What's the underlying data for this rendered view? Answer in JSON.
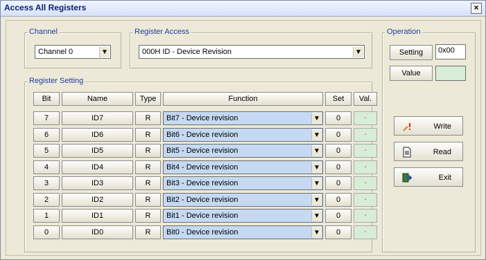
{
  "window": {
    "title": "Access All Registers",
    "close_glyph": "×"
  },
  "channel": {
    "label": "Channel",
    "value": "Channel 0"
  },
  "register_access": {
    "label": "Register Access",
    "value": "000H ID - Device Revision"
  },
  "operation": {
    "label": "Operation",
    "setting_label": "Setting",
    "setting_value": "0x00",
    "value_label": "Value",
    "value_value": "",
    "write_label": "Write",
    "read_label": "Read",
    "exit_label": "Exit",
    "write_icon": "write-icon",
    "read_icon": "document-icon",
    "exit_icon": "exit-icon"
  },
  "register_setting": {
    "label": "Register Setting",
    "headers": {
      "bit": "Bit",
      "name": "Name",
      "type": "Type",
      "function": "Function",
      "set": "Set",
      "val": "Val."
    },
    "rows": [
      {
        "bit": "7",
        "name": "ID7",
        "type": "R",
        "function": "Bit7 - Device revision",
        "set": "0",
        "val": "-"
      },
      {
        "bit": "6",
        "name": "ID6",
        "type": "R",
        "function": "Bit6 - Device revision",
        "set": "0",
        "val": "-"
      },
      {
        "bit": "5",
        "name": "ID5",
        "type": "R",
        "function": "Bit5 - Device revision",
        "set": "0",
        "val": "-"
      },
      {
        "bit": "4",
        "name": "ID4",
        "type": "R",
        "function": "Bit4 - Device revision",
        "set": "0",
        "val": "-"
      },
      {
        "bit": "3",
        "name": "ID3",
        "type": "R",
        "function": "Bit3 - Device revision",
        "set": "0",
        "val": "-"
      },
      {
        "bit": "2",
        "name": "ID2",
        "type": "R",
        "function": "Bit2 - Device revision",
        "set": "0",
        "val": "-"
      },
      {
        "bit": "1",
        "name": "ID1",
        "type": "R",
        "function": "Bit1 - Device revision",
        "set": "0",
        "val": "-"
      },
      {
        "bit": "0",
        "name": "ID0",
        "type": "R",
        "function": "Bit0 - Device revision",
        "set": "0",
        "val": "-"
      }
    ]
  },
  "colors": {
    "title_text": "#0a246a",
    "group_label": "#1f3fa0",
    "function_bg": "#c5daf2",
    "val_bg": "#d8edd8"
  }
}
